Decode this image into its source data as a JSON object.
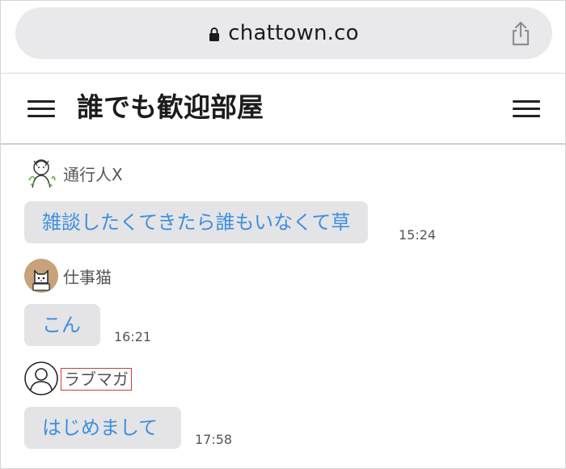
{
  "browser": {
    "url": "chattown.co",
    "lock_icon": "lock-icon",
    "share_icon": "share-icon"
  },
  "header": {
    "title": "誰でも歓迎部屋",
    "left_menu_icon": "hamburger-menu-icon",
    "right_menu_icon": "hamburger-menu-icon"
  },
  "messages": [
    {
      "user": "通行人X",
      "text": "雑談したくてきたら誰もいなくて草",
      "time": "15:24",
      "avatar": "sketch-avatar"
    },
    {
      "user": "仕事猫",
      "text": "こん",
      "time": "16:21",
      "avatar": "cat-avatar"
    },
    {
      "user": "ラブマガ",
      "text": "はじめまして",
      "time": "17:58",
      "avatar": "default-user-avatar"
    }
  ],
  "colors": {
    "bubble_bg": "#e4e4e6",
    "bubble_text": "#3d8fe0",
    "highlight_border": "#d23a3a"
  }
}
